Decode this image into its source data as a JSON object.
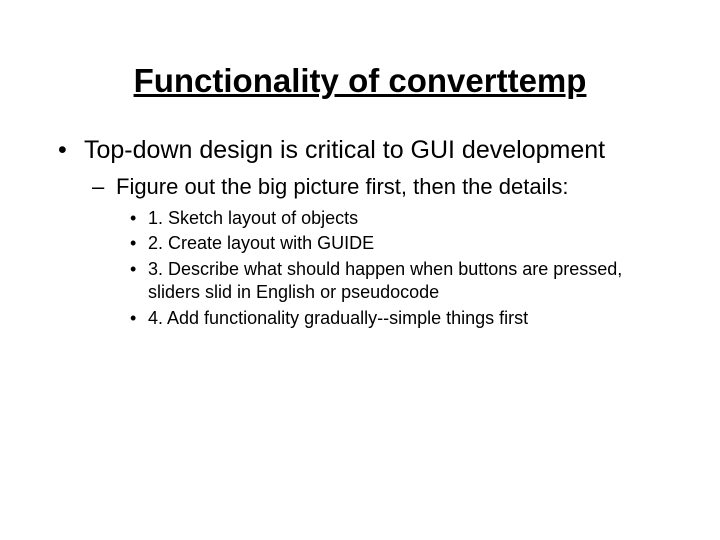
{
  "title": "Functionality of converttemp",
  "bullets": {
    "l1": "Top-down design is critical to GUI development",
    "l2": "Figure out the big picture first, then the details:",
    "l3": {
      "a": "1. Sketch layout of objects",
      "b": "2. Create layout with GUIDE",
      "c": "3. Describe what should happen when buttons are pressed, sliders slid in English or pseudocode",
      "d": "4. Add functionality gradually--simple things first"
    }
  }
}
